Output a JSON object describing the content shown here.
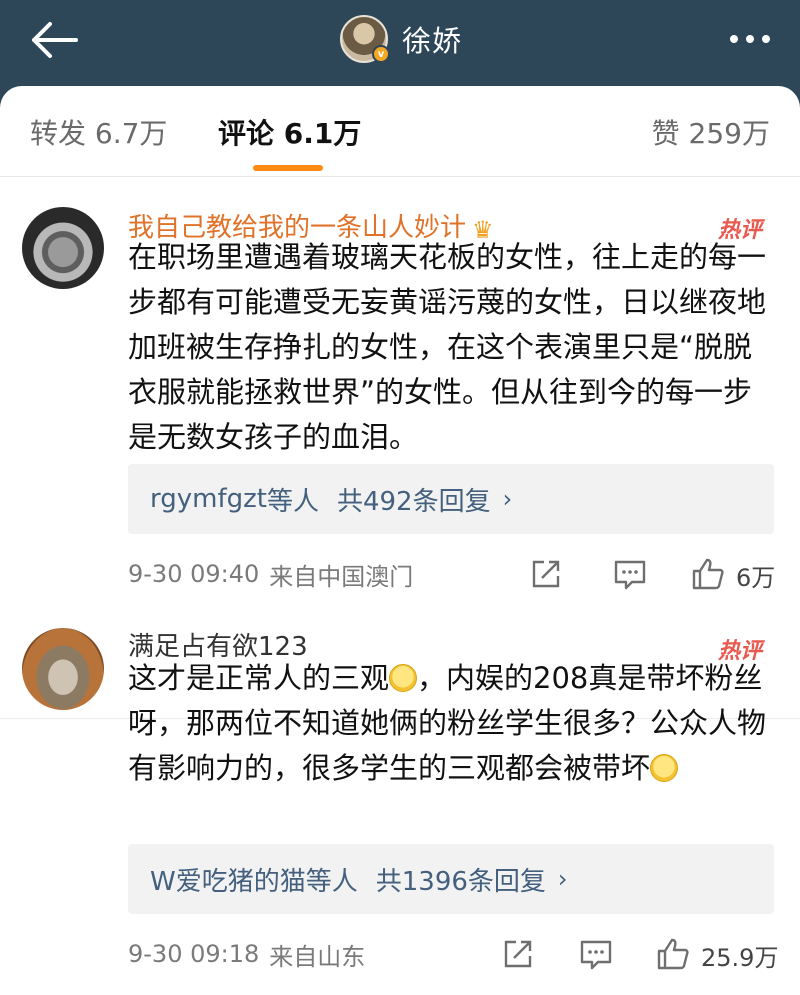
{
  "header": {
    "user_name": "徐娇",
    "verified_badge": "v",
    "icons": {
      "back": "back-arrow-icon",
      "more": "more-dots-icon"
    }
  },
  "tabs": {
    "forward": "转发 6.7万",
    "comment": "评论 6.1万",
    "like": "赞 259万",
    "active_color": "#ff8b12"
  },
  "comments": [
    {
      "user": "我自己教给我的一条山人妙计",
      "user_color": "#e0722a",
      "badge": "crown-icon",
      "hot_tag": "热评",
      "text": "在职场里遭遇着玻璃天花板的女性，往上走的每一步都有可能遭受无妄黄谣污蔑的女性，日以继夜地加班被生存挣扎的女性，在这个表演里只是“脱脱衣服就能拯救世界”的女性。但从往到今的每一步是无数女孩子的血泪。",
      "reply_users": "rgymfgzt",
      "reply_etc": "等人",
      "reply_count": "共492条回复",
      "time": "9-30 09:40",
      "source": "来自中国澳门",
      "likes": "6万"
    },
    {
      "user": "满足占有欲123",
      "hot_tag": "热评",
      "text_part1": "这才是正常人的三观",
      "text_part2": "，内娱的208真是带坏粉丝呀，那两位不知道她俩的粉丝学生很多？公众人物有影响力的，很多学生的三观都会被带坏",
      "reply_users": "W爱吃猪的猫",
      "reply_etc": "等人",
      "reply_count": "共1396条回复",
      "time": "9-30 09:18",
      "source": "来自山东",
      "likes": "25.9万"
    }
  ],
  "colors": {
    "header_bg": "#2d4658",
    "link": "#44607e",
    "hot": "#e85a4f"
  }
}
